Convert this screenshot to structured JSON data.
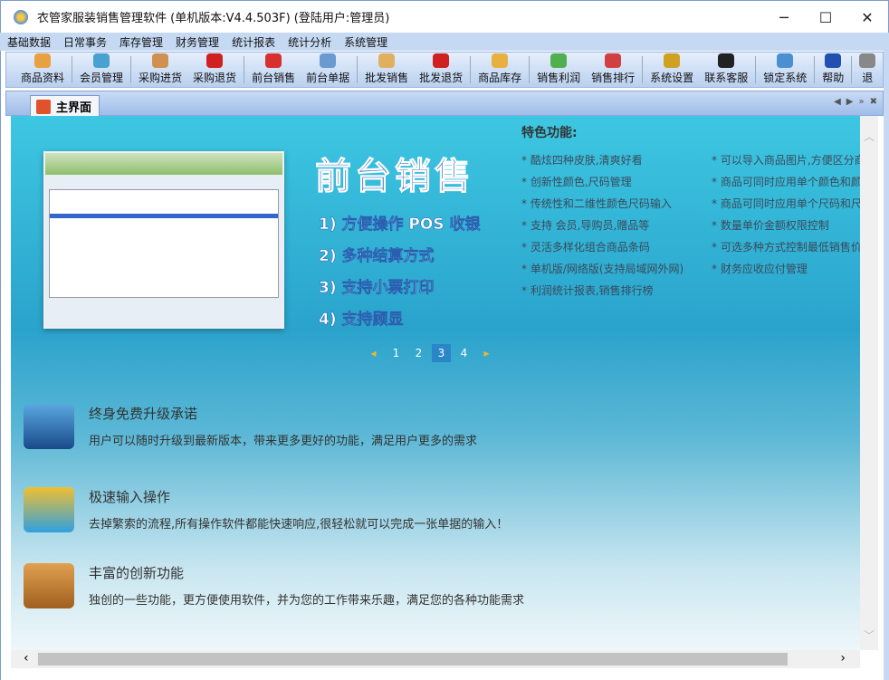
{
  "window": {
    "title": "衣管家服装销售管理软件 (单机版本:V4.4.503F) (登陆用户:管理员)",
    "minimize": "─",
    "maximize": "☐",
    "close": "✕"
  },
  "menu": [
    "基础数据",
    "日常事务",
    "库存管理",
    "财务管理",
    "统计报表",
    "统计分析",
    "系统管理"
  ],
  "toolbar": [
    {
      "label": "商品资料",
      "color": "#e8a040"
    },
    {
      "label": "会员管理",
      "color": "#4aa0d0"
    },
    {
      "label": "采购进货",
      "color": "#d09050"
    },
    {
      "label": "采购退货",
      "color": "#d02020"
    },
    {
      "label": "前台销售",
      "color": "#d83030"
    },
    {
      "label": "前台单据",
      "color": "#6a9ad0"
    },
    {
      "label": "批发销售",
      "color": "#e0b060"
    },
    {
      "label": "批发退货",
      "color": "#d02020"
    },
    {
      "label": "商品库存",
      "color": "#e8b040"
    },
    {
      "label": "销售利润",
      "color": "#50b050"
    },
    {
      "label": "销售排行",
      "color": "#d04040"
    },
    {
      "label": "系统设置",
      "color": "#d0a020"
    },
    {
      "label": "联系客服",
      "color": "#222222"
    },
    {
      "label": "锁定系统",
      "color": "#4a90d0"
    },
    {
      "label": "帮助",
      "color": "#2050b0"
    },
    {
      "label": "退",
      "color": "#888888"
    }
  ],
  "tab": {
    "label": "主界面"
  },
  "banner": {
    "heading": "前台销售",
    "points": [
      "1) 方便操作 POS 收银",
      "2) 多种结算方式",
      "3) 支持小票打印",
      "4) 支持顾显"
    ]
  },
  "features": {
    "title": "特色功能:",
    "left": [
      "* 酷炫四种皮肤,清爽好看",
      "* 创新性颜色,尺码管理",
      "* 传统性和二维性颜色尺码输入",
      "* 支持 会员,导购员,赠品等",
      "* 灵活多样化组合商品条码",
      "* 单机版/网络版(支持局域网外网)",
      "* 利润统计报表,销售排行榜"
    ],
    "right": [
      "* 可以导入商品图片,方便区分商",
      "* 商品可同时应用单个颜色和颜",
      "* 商品可同时应用单个尺码和尺",
      "* 数量单价金额权限控制",
      "* 可选多种方式控制最低销售价",
      "* 财务应收应付管理"
    ]
  },
  "pager": {
    "prev": "◂",
    "pages": [
      "1",
      "2",
      "3",
      "4"
    ],
    "current": "3",
    "next": "▸"
  },
  "blocks": [
    {
      "title": "终身免费升级承诺",
      "desc": "用户可以随时升级到最新版本，带来更多更好的功能，满足用户更多的需求"
    },
    {
      "title": "极速输入操作",
      "desc": "去掉繁索的流程,所有操作软件都能快速响应,很轻松就可以完成一张单据的输入！"
    },
    {
      "title": "丰富的创新功能",
      "desc": "独创的一些功能，更方便使用软件，并为您的工作带来乐趣，满足您的各种功能需求"
    }
  ]
}
